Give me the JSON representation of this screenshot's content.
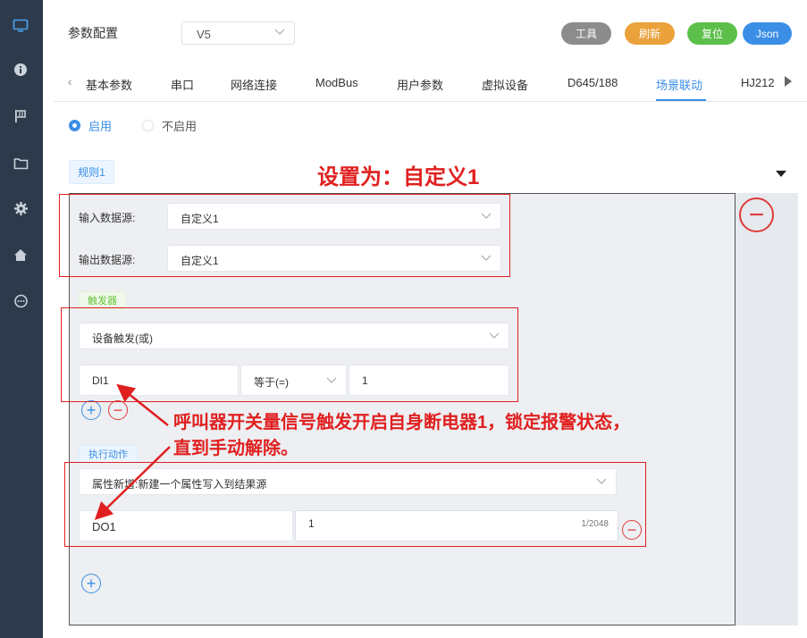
{
  "sidebar": {
    "icons": [
      "monitor-icon",
      "info-icon",
      "flag-icon",
      "folder-icon",
      "gear-icon",
      "home-icon",
      "chat-icon"
    ]
  },
  "header": {
    "title": "参数配置",
    "version": "V5",
    "buttons": {
      "tools": "工具",
      "refresh": "刷新",
      "reset": "复位",
      "json": "Json"
    }
  },
  "tabs": [
    {
      "label": "基本参数"
    },
    {
      "label": "串口"
    },
    {
      "label": "网络连接"
    },
    {
      "label": "ModBus"
    },
    {
      "label": "用户参数"
    },
    {
      "label": "虚拟设备"
    },
    {
      "label": "D645/188"
    },
    {
      "label": "场景联动",
      "active": true
    },
    {
      "label": "HJ212"
    }
  ],
  "radios": {
    "enabled": "启用",
    "disabled": "不启用",
    "selected": "启用"
  },
  "rule": {
    "tag": "规则1",
    "input_source_label": "输入数据源:",
    "input_source_value": "自定义1",
    "output_source_label": "输出数据源:",
    "output_source_value": "自定义1"
  },
  "trigger": {
    "tag": "触发器",
    "type": "设备触发(或)",
    "variable": "DI1",
    "operator": "等于(=)",
    "value": "1"
  },
  "action": {
    "tag": "执行动作",
    "type": "属性新增:新建一个属性写入到结果源",
    "target": "DO1",
    "value": "1",
    "counter": "1/2048"
  },
  "annotations": {
    "title_note": "设置为：自定义1",
    "trigger_note_line1": "呼叫器开关量信号触发开启自身断电器1，锁定报警状态，",
    "trigger_note_line2": "直到手动解除。"
  },
  "colors": {
    "accent": "#3a8ee6",
    "annotation": "#e02020",
    "sidebar": "#2d3a4b"
  }
}
